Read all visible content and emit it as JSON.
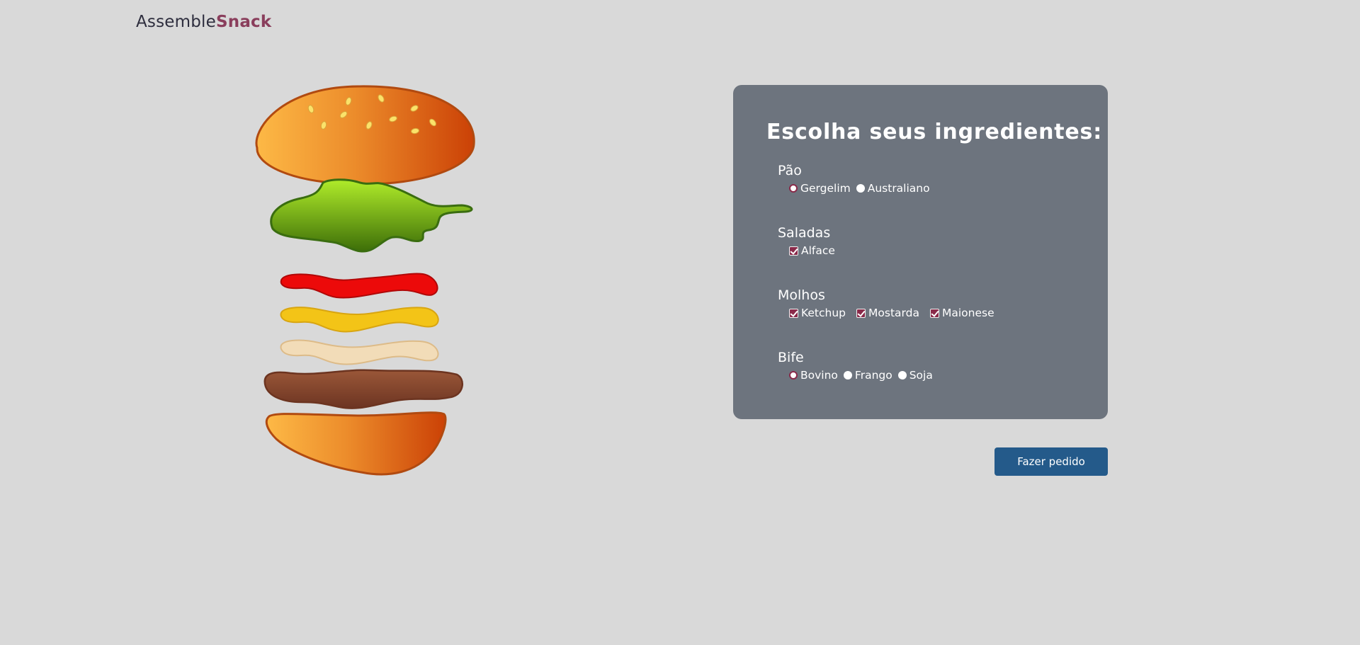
{
  "header": {
    "logo_part1": "Assemble",
    "logo_part2": "Snack"
  },
  "panel": {
    "title": "Escolha seus ingredientes:",
    "groups": [
      {
        "title": "Pão",
        "type": "radio",
        "options": [
          {
            "label": "Gergelim",
            "checked": true
          },
          {
            "label": "Australiano",
            "checked": false
          }
        ]
      },
      {
        "title": "Saladas",
        "type": "checkbox",
        "options": [
          {
            "label": "Alface",
            "checked": true
          }
        ]
      },
      {
        "title": "Molhos",
        "type": "checkbox",
        "options": [
          {
            "label": "Ketchup",
            "checked": true
          },
          {
            "label": "Mostarda",
            "checked": true
          },
          {
            "label": "Maionese",
            "checked": true
          }
        ]
      },
      {
        "title": "Bife",
        "type": "radio",
        "options": [
          {
            "label": "Bovino",
            "checked": true
          },
          {
            "label": "Frango",
            "checked": false
          },
          {
            "label": "Soja",
            "checked": false
          }
        ]
      }
    ]
  },
  "order_button": "Fazer pedido",
  "colors": {
    "background": "#d9d9d9",
    "panel": "#6d747e",
    "accent": "#8a2a4a",
    "button": "#245a8a"
  }
}
